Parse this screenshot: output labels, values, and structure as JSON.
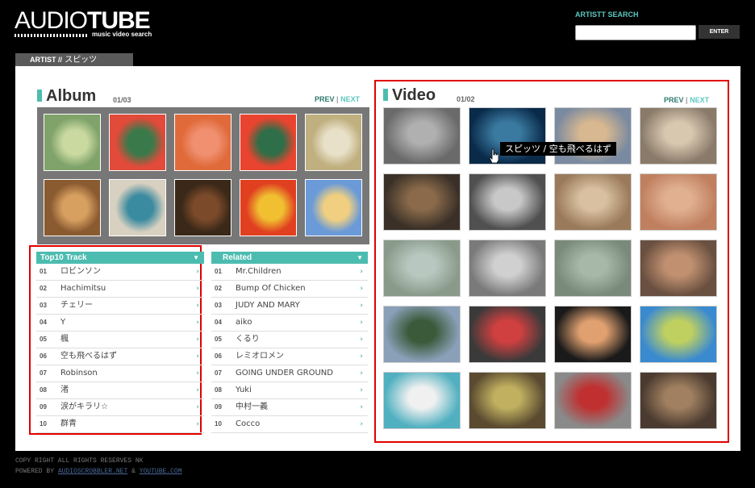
{
  "header": {
    "logo_audio": "AUDIO",
    "logo_tube": "TUBE",
    "logo_sub": "music video search",
    "search_label": "ARTISTT SEARCH",
    "search_value": "",
    "enter_label": "ENTER"
  },
  "breadcrumb": {
    "prefix": "ARTIST //",
    "artist": "スピッツ"
  },
  "album": {
    "title": "Album",
    "page": "01/03",
    "prev": "PREV",
    "sep": "|",
    "next": "NEXT",
    "covers": [
      {
        "bg": "#7fa36a",
        "accent": "#c9d9a0"
      },
      {
        "bg": "#e24a3a",
        "accent": "#3a7a4a"
      },
      {
        "bg": "#e06a3a",
        "accent": "#f09070"
      },
      {
        "bg": "#e8442f",
        "accent": "#2e6e48"
      },
      {
        "bg": "#c0b080",
        "accent": "#e8e0c8"
      },
      {
        "bg": "#8a5a30",
        "accent": "#d8a060"
      },
      {
        "bg": "#d8d0c0",
        "accent": "#3a8aa0"
      },
      {
        "bg": "#3a2818",
        "accent": "#7a4a2a"
      },
      {
        "bg": "#e04020",
        "accent": "#f0c030"
      },
      {
        "bg": "#6a9ad8",
        "accent": "#f0d080"
      }
    ]
  },
  "top10": {
    "title": "Top10 Track",
    "items": [
      {
        "num": "01",
        "name": "ロビンソン"
      },
      {
        "num": "02",
        "name": "Hachimitsu"
      },
      {
        "num": "03",
        "name": "チェリー"
      },
      {
        "num": "04",
        "name": "Y"
      },
      {
        "num": "05",
        "name": "楓"
      },
      {
        "num": "06",
        "name": "空も飛べるはず"
      },
      {
        "num": "07",
        "name": "Robinson"
      },
      {
        "num": "08",
        "name": "渚"
      },
      {
        "num": "09",
        "name": "涙がキラリ☆"
      },
      {
        "num": "10",
        "name": "群青"
      }
    ]
  },
  "related": {
    "title": "Related",
    "items": [
      {
        "num": "01",
        "name": "Mr.Children"
      },
      {
        "num": "02",
        "name": "Bump Of Chicken"
      },
      {
        "num": "03",
        "name": "JUDY AND MARY"
      },
      {
        "num": "04",
        "name": "aiko"
      },
      {
        "num": "05",
        "name": "くるり"
      },
      {
        "num": "06",
        "name": "レミオロメン"
      },
      {
        "num": "07",
        "name": "GOING UNDER GROUND"
      },
      {
        "num": "08",
        "name": "Yuki"
      },
      {
        "num": "09",
        "name": "中村一義"
      },
      {
        "num": "10",
        "name": "Cocco"
      }
    ]
  },
  "video": {
    "title": "Video",
    "page": "01/02",
    "prev": "PREV",
    "sep": "|",
    "next": "NEXT",
    "tooltip": "スピッツ / 空も飛べるはず",
    "thumbs": [
      {
        "bg": "#6a6a6a",
        "accent": "#b0b0b0"
      },
      {
        "bg": "#0a2a4a",
        "accent": "#3a7aa0"
      },
      {
        "bg": "#7a8aa0",
        "accent": "#d8b890"
      },
      {
        "bg": "#8a7a6a",
        "accent": "#d8c8b0"
      },
      {
        "bg": "#3a3028",
        "accent": "#8a6a4a"
      },
      {
        "bg": "#505050",
        "accent": "#c8c8c8"
      },
      {
        "bg": "#9a7a5a",
        "accent": "#d8c0a0"
      },
      {
        "bg": "#c08060",
        "accent": "#e0b090"
      },
      {
        "bg": "#8a9a8a",
        "accent": "#b8c8c0"
      },
      {
        "bg": "#7a7a7a",
        "accent": "#d0d0d0"
      },
      {
        "bg": "#7a8a7a",
        "accent": "#a8b8a8"
      },
      {
        "bg": "#6a5040",
        "accent": "#c09070"
      },
      {
        "bg": "#8aa0b8",
        "accent": "#3a5a3a"
      },
      {
        "bg": "#3a3a3a",
        "accent": "#d04040"
      },
      {
        "bg": "#1a1a1a",
        "accent": "#e0a070"
      },
      {
        "bg": "#3a8ad0",
        "accent": "#c0d060"
      },
      {
        "bg": "#50b0c0",
        "accent": "#f0f0f0"
      },
      {
        "bg": "#5a4a30",
        "accent": "#c0b060"
      },
      {
        "bg": "#8a8a8a",
        "accent": "#c03030"
      },
      {
        "bg": "#4a3a30",
        "accent": "#a08060"
      }
    ]
  },
  "footer": {
    "copyright": "COPY RIGHT ALL RIGHTS RESERVES NK",
    "powered_by": "POWERED BY",
    "link1": "AUDIOSCROBBLER.NET",
    "amp": "&",
    "link2": "YOUTUBE.COM"
  }
}
